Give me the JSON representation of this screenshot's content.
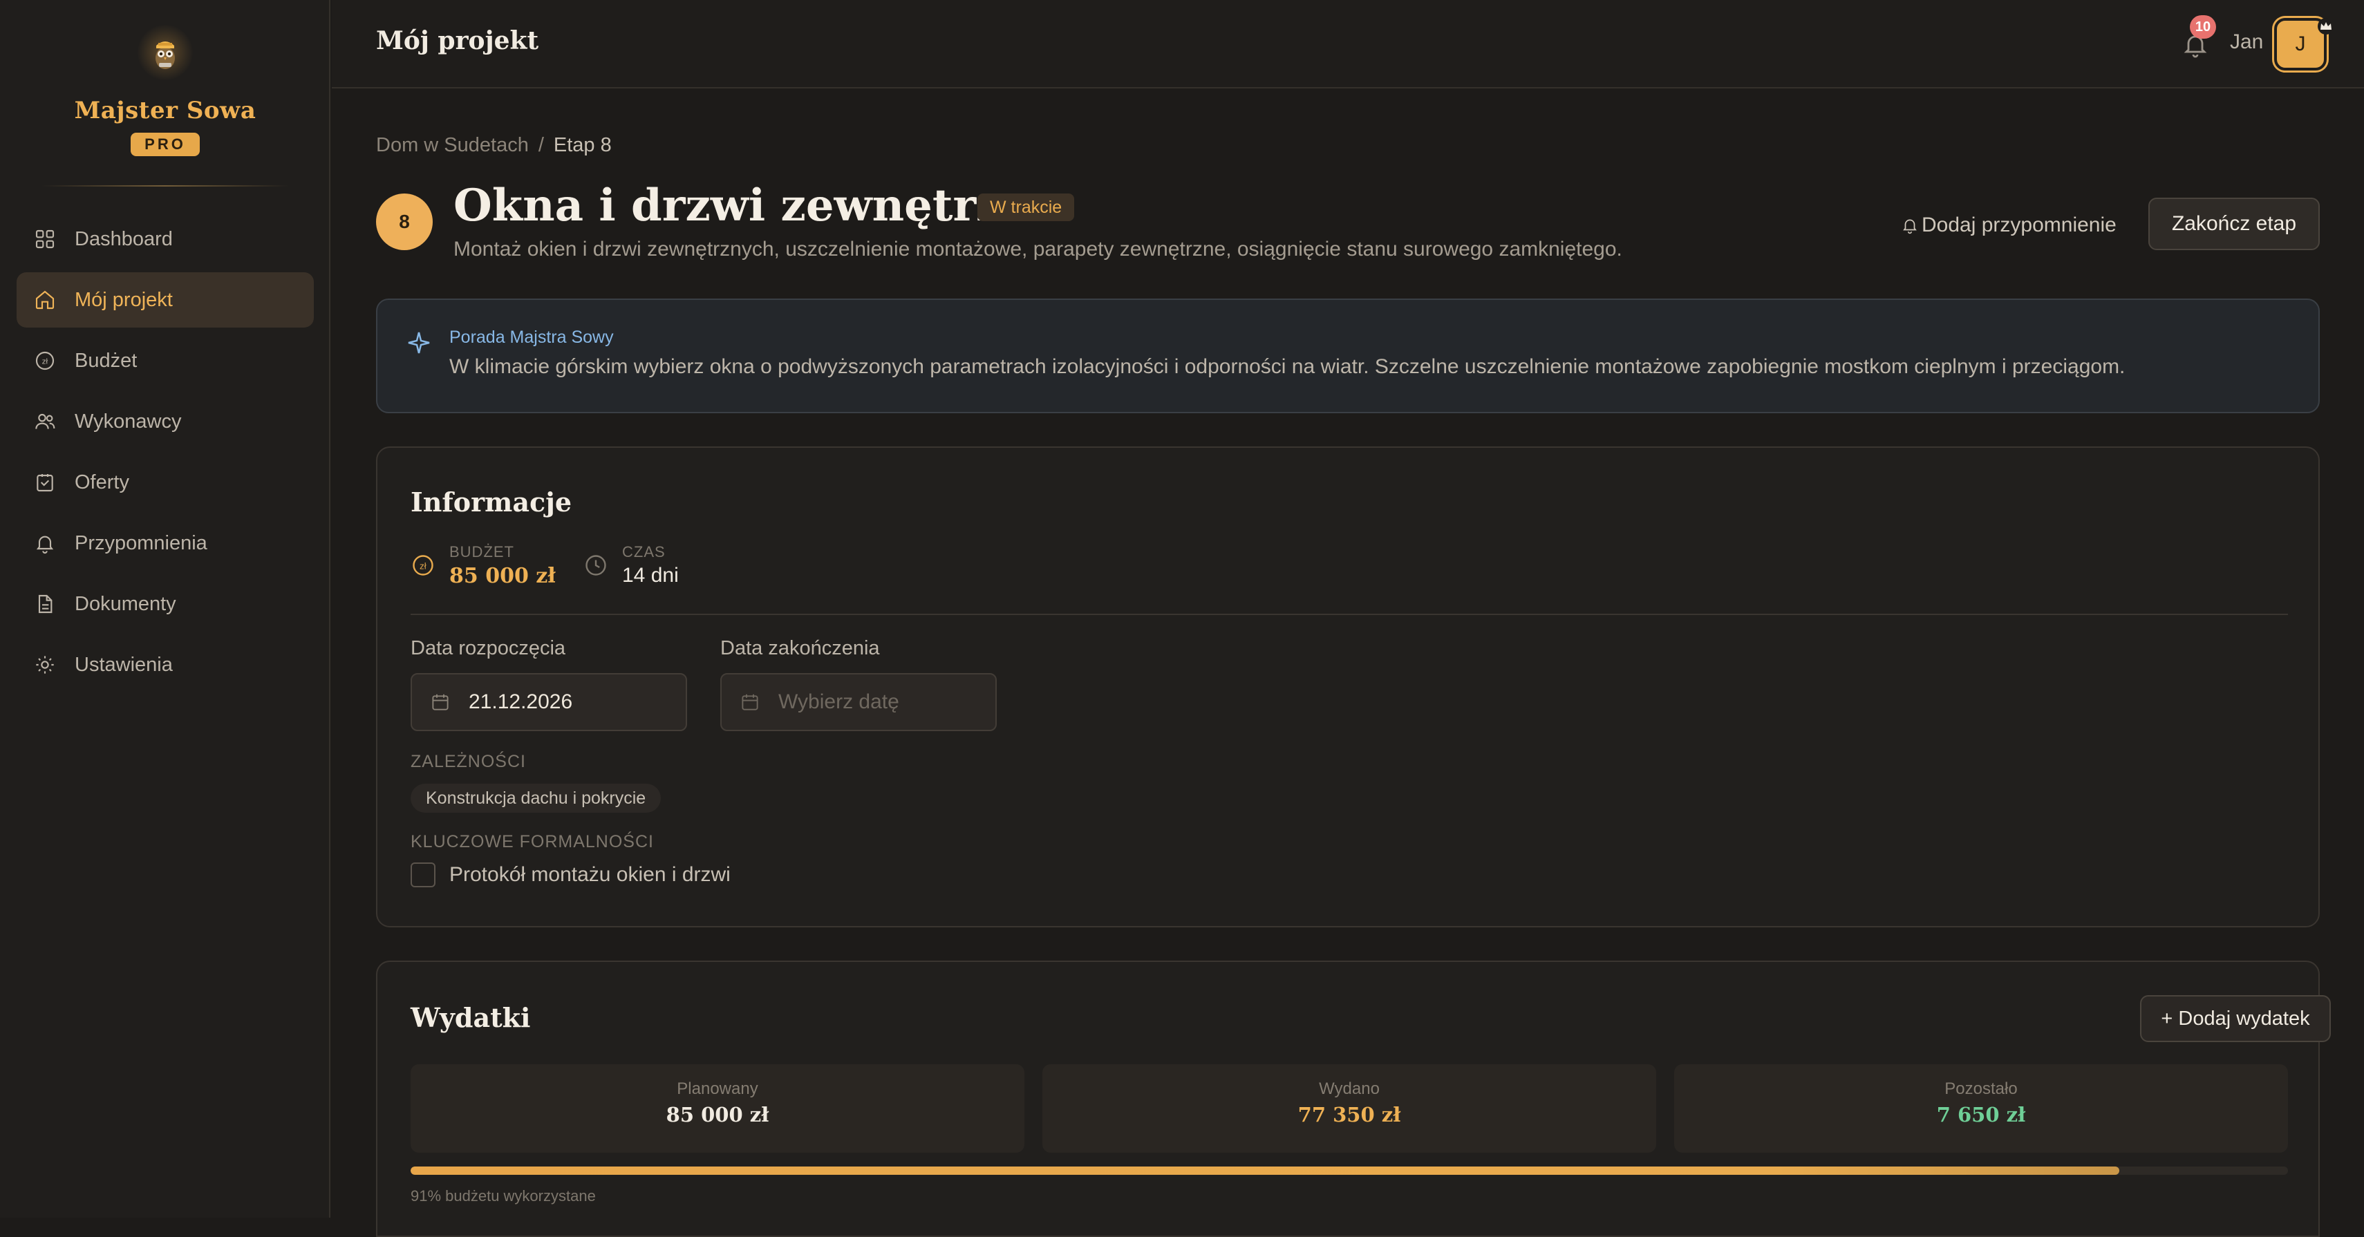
{
  "brand": {
    "name": "Majster Sowa",
    "tier": "PRO"
  },
  "sidebar": {
    "items": [
      {
        "label": "Dashboard",
        "icon": "grid-icon"
      },
      {
        "label": "Mój projekt",
        "icon": "home-icon",
        "active": true
      },
      {
        "label": "Budżet",
        "icon": "zloty-coin-icon"
      },
      {
        "label": "Wykonawcy",
        "icon": "users-icon"
      },
      {
        "label": "Oferty",
        "icon": "clipboard-icon"
      },
      {
        "label": "Przypomnienia",
        "icon": "bell-icon"
      },
      {
        "label": "Dokumenty",
        "icon": "document-icon"
      },
      {
        "label": "Ustawienia",
        "icon": "sun-icon"
      }
    ]
  },
  "topbar": {
    "title": "Mój projekt",
    "notification_count": "10",
    "user_name": "Jan",
    "avatar_initial": "J"
  },
  "breadcrumb": {
    "parent": "Dom w Sudetach",
    "separator": "/",
    "current": "Etap 8"
  },
  "stage": {
    "number": "8",
    "title": "Okna i drzwi zewnętrzne",
    "status": "W trakcie",
    "description": "Montaż okien i drzwi zewnętrznych, uszczelnienie montażowe, parapety zewnętrzne, osiągnięcie stanu surowego zamkniętego.",
    "reminder_label": "Dodaj przypomnienie",
    "finish_label": "Zakończ etap"
  },
  "tip": {
    "title": "Porada Majstra Sowy",
    "text": "W klimacie górskim wybierz okna o podwyższonych parametrach izolacyjności i odporności na wiatr. Szczelne uszczelnienie montażowe zapobiegnie mostkom cieplnym i przeciągom."
  },
  "info": {
    "title": "Informacje",
    "budget_label": "BUDŻET",
    "budget_value": "85 000 zł",
    "time_label": "CZAS",
    "time_value": "14 dni",
    "start_label": "Data rozpoczęcia",
    "start_value": "21.12.2026",
    "end_label": "Data zakończenia",
    "end_placeholder": "Wybierz datę",
    "dependencies_label": "ZALEŻNOŚCI",
    "dependencies": [
      "Konstrukcja dachu i pokrycie"
    ],
    "formalities_label": "KLUCZOWE FORMALNOŚCI",
    "formalities": [
      {
        "label": "Protokół montażu okien i drzwi",
        "checked": false
      }
    ]
  },
  "expenses": {
    "title": "Wydatki",
    "add_label": "+ Dodaj wydatek",
    "planned_label": "Planowany",
    "planned_value": "85 000 zł",
    "spent_label": "Wydano",
    "spent_value": "77 350 zł",
    "remaining_label": "Pozostało",
    "remaining_value": "7 650 zł",
    "used_fraction": 0.91,
    "used_caption": "91% budżetu wykorzystane"
  },
  "colors": {
    "accent": "#e9ab4e",
    "remaining_green": "#6fcf97",
    "tip_blue": "#88b8e6",
    "badge_red": "#e7726e"
  }
}
